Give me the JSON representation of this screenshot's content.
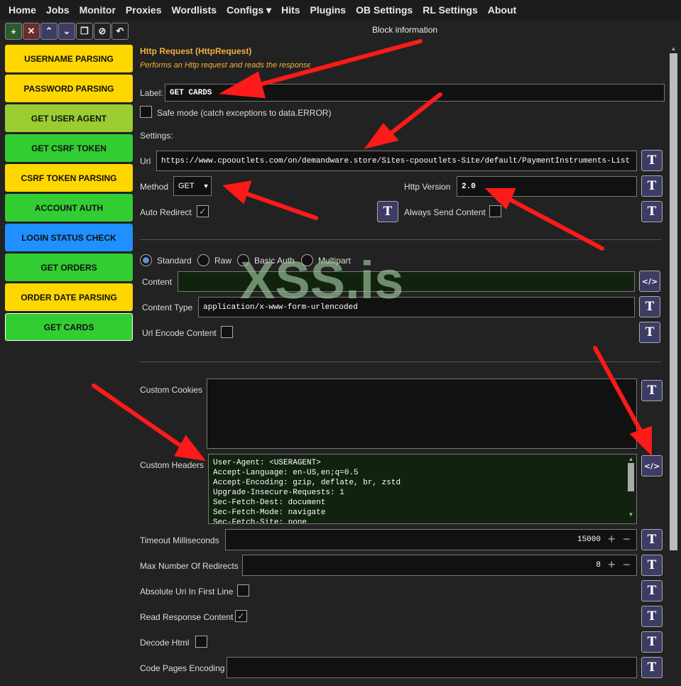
{
  "nav": [
    "Home",
    "Jobs",
    "Monitor",
    "Proxies",
    "Wordlists",
    "Configs ▾",
    "Hits",
    "Plugins",
    "OB Settings",
    "RL Settings",
    "About"
  ],
  "toolbar": [
    "+",
    "✕",
    "⌃",
    "⌄",
    "❐",
    "⊘",
    "↶"
  ],
  "blocks": [
    {
      "label": "USERNAME PARSING",
      "color": "#ffd700"
    },
    {
      "label": "PASSWORD PARSING",
      "color": "#ffd700"
    },
    {
      "label": "GET USER AGENT",
      "color": "#9acd32"
    },
    {
      "label": "GET CSRF TOKEN",
      "color": "#32cd32"
    },
    {
      "label": "CSRF TOKEN PARSING",
      "color": "#ffd700"
    },
    {
      "label": "ACCOUNT AUTH",
      "color": "#32cd32"
    },
    {
      "label": "LOGIN STATUS CHECK",
      "color": "#1e90ff"
    },
    {
      "label": "GET ORDERS",
      "color": "#32cd32"
    },
    {
      "label": "ORDER DATE PARSING",
      "color": "#ffd700"
    },
    {
      "label": "GET CARDS",
      "color": "#32cd32"
    }
  ],
  "panel": {
    "header": "Block information",
    "title": "Http Request (HttpRequest)",
    "description": "Performs an Http request and reads the response",
    "label_caption": "Label:",
    "label_value": "GET CARDS",
    "safe_mode": "Safe mode (catch exceptions to data.ERROR)",
    "settings": "Settings:",
    "url_caption": "Url",
    "url": "https://www.cpooutlets.com/on/demandware.store/Sites-cpooutlets-Site/default/PaymentInstruments-List",
    "method_caption": "Method",
    "method": "GET",
    "http_version_caption": "Http Version",
    "http_version": "2.0",
    "auto_redirect": "Auto Redirect",
    "always_send": "Always Send Content",
    "modes": [
      "Standard",
      "Raw",
      "Basic Auth",
      "Multipart"
    ],
    "content": "Content",
    "content_type_caption": "Content Type",
    "content_type": "application/x-www-form-urlencoded",
    "url_encode": "Url Encode Content",
    "custom_cookies": "Custom Cookies",
    "custom_headers": "Custom Headers",
    "headers": [
      "User-Agent: <USERAGENT>",
      "Accept-Language: en-US,en;q=0.5",
      "Accept-Encoding: gzip, deflate, br, zstd",
      "Upgrade-Insecure-Requests: 1",
      "Sec-Fetch-Dest: document",
      "Sec-Fetch-Mode: navigate",
      "Sec-Fetch-Site: none"
    ],
    "timeout_caption": "Timeout Milliseconds",
    "timeout": "15000",
    "max_redirects_caption": "Max Number Of Redirects",
    "max_redirects": "8",
    "absolute_uri": "Absolute Uri In First Line",
    "read_response": "Read Response Content",
    "decode_html": "Decode Html",
    "code_pages": "Code Pages Encoding"
  },
  "watermark": "XSS.is"
}
